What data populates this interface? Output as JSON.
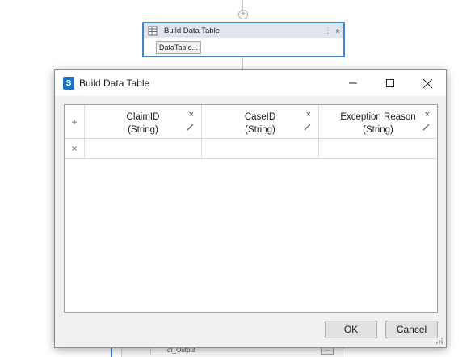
{
  "designer": {
    "add_glyph": "+",
    "activity": {
      "title": "Build Data Table",
      "icon": "table-icon",
      "menu_glyph": "⋮",
      "collapse_glyph": "«",
      "datatable_button_label": "DataTable..."
    },
    "lower_activity": {
      "field_value": "dt_Output",
      "button_label": "..."
    }
  },
  "dialog": {
    "title": "Build Data Table",
    "app_icon": "S",
    "window_buttons": {
      "minimize": "minimize-icon",
      "maximize": "maximize-icon",
      "close": "close-icon"
    },
    "grid": {
      "add_column_glyph": "+",
      "columns": [
        {
          "name": "ClaimID",
          "type": "(String)"
        },
        {
          "name": "CaseID",
          "type": "(String)"
        },
        {
          "name": "Exception Reason",
          "type": "(String)"
        }
      ],
      "remove_glyph": "×",
      "rows": [
        {
          "delete_glyph": "×",
          "cells": [
            "",
            "",
            ""
          ]
        }
      ]
    },
    "buttons": {
      "ok": "OK",
      "cancel": "Cancel"
    }
  },
  "colors": {
    "accent": "#3c86d6",
    "app_icon": "#1c72c4",
    "dialog_bg": "#f0f0f0",
    "button_bg": "#e1e1e1"
  }
}
